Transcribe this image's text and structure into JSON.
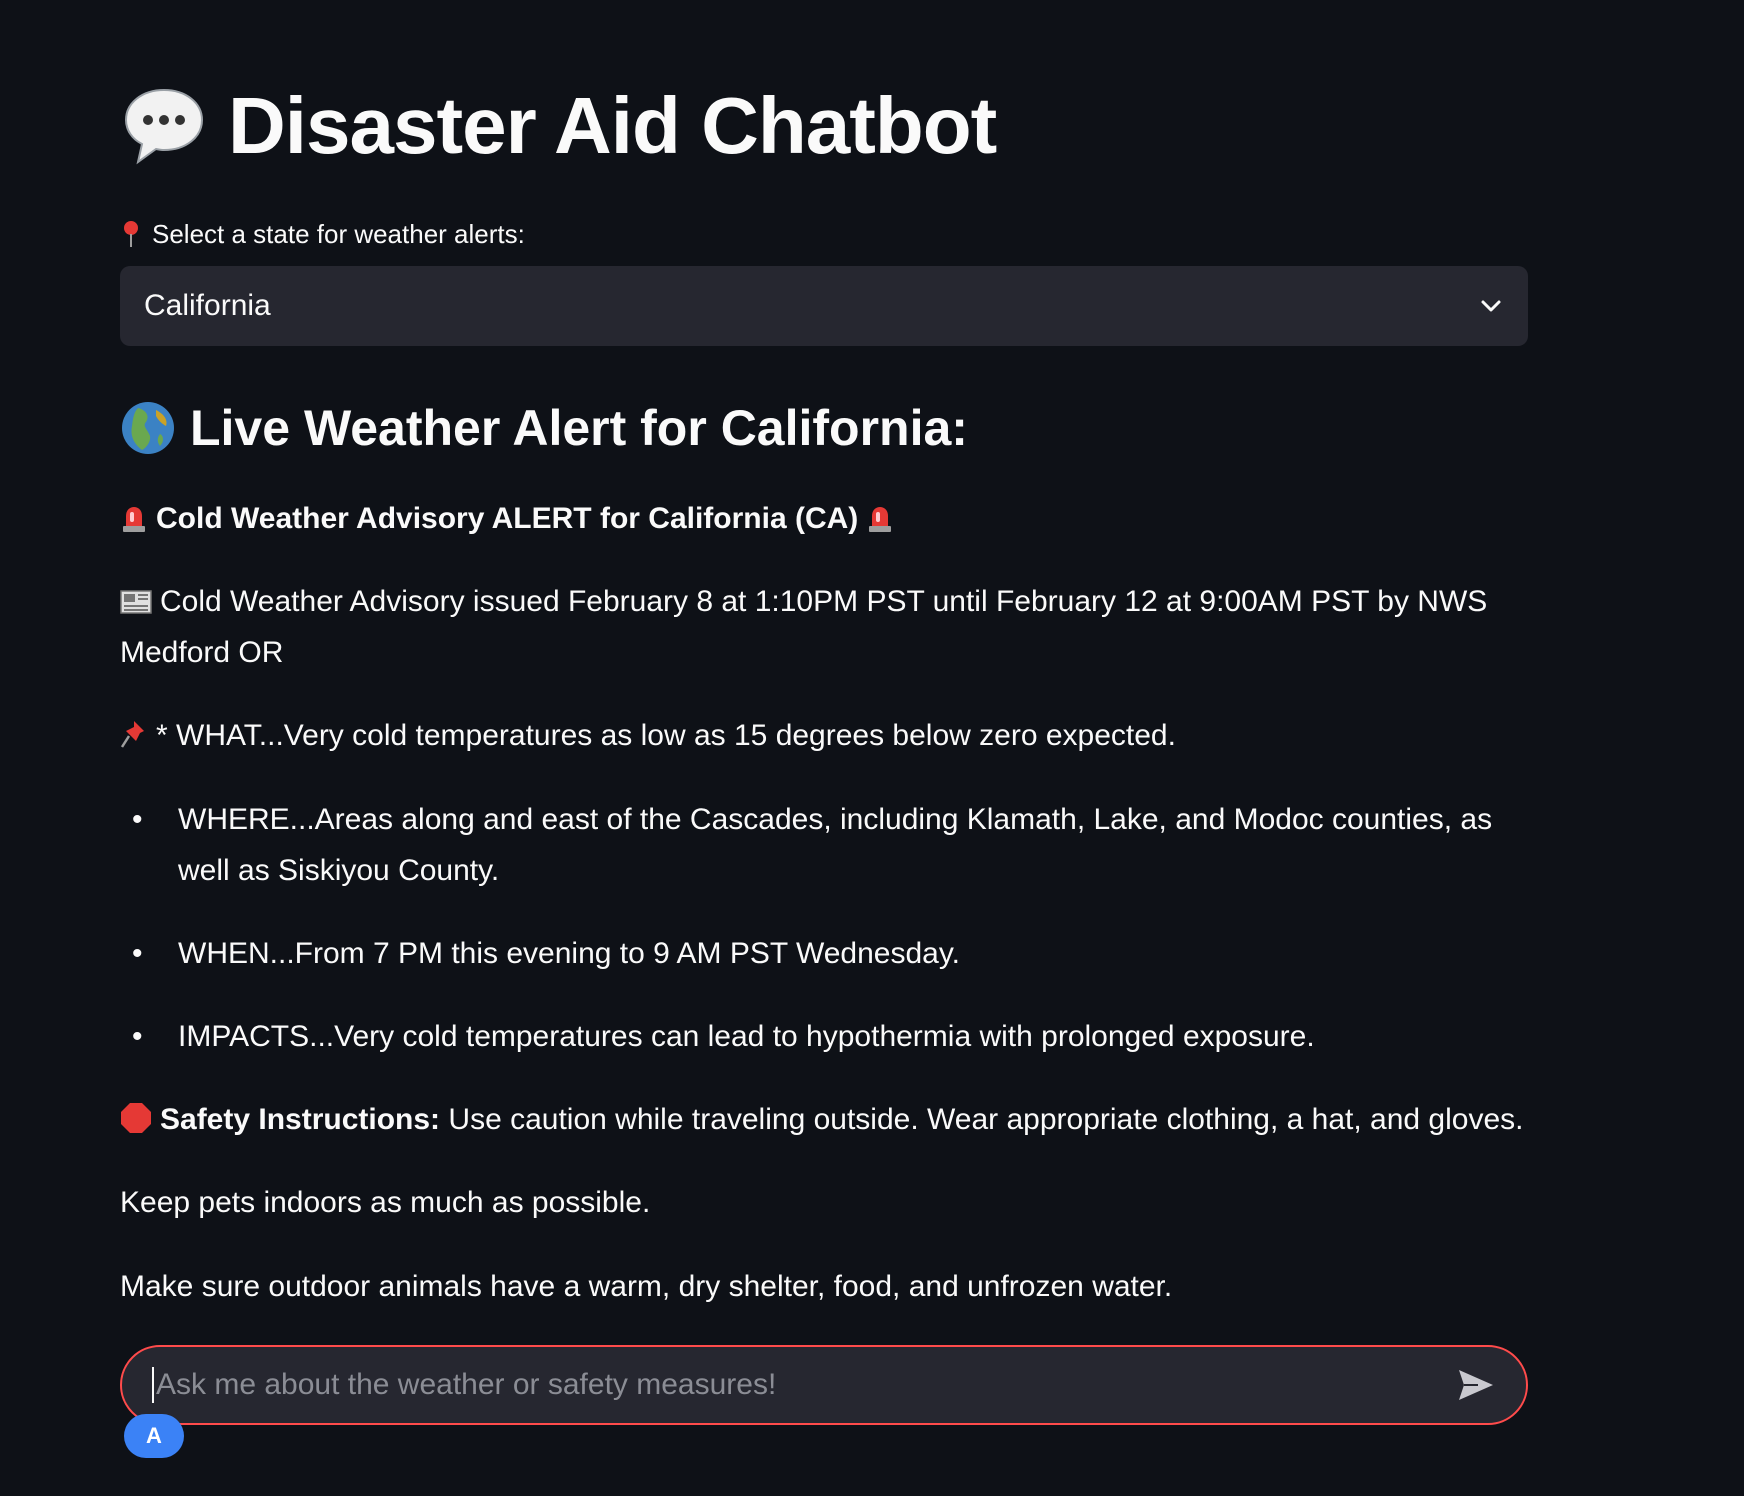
{
  "app": {
    "title": "Disaster Aid Chatbot",
    "title_icon": "speech-bubble-icon"
  },
  "state_select": {
    "label": "Select a state for weather alerts:",
    "label_icon": "round-pushpin-icon",
    "selected_value": "California"
  },
  "alert_section": {
    "heading": "Live Weather Alert for California:",
    "heading_icon": "globe-icon",
    "alert_title": "Cold Weather Advisory ALERT for California (CA)",
    "alert_title_icon": "siren-icon",
    "issued_text": "Cold Weather Advisory issued February 8 at 1:10PM PST until February 12 at 9:00AM PST by NWS Medford OR",
    "issued_icon": "newspaper-icon",
    "what_text": "* WHAT...Very cold temperatures as low as 15 degrees below zero expected.",
    "what_icon": "pushpin-icon",
    "bullets": [
      "WHERE...Areas along and east of the Cascades, including Klamath, Lake, and Modoc counties, as well as Siskiyou County.",
      "WHEN...From 7 PM this evening to 9 AM PST Wednesday.",
      "IMPACTS...Very cold temperatures can lead to hypothermia with prolonged exposure."
    ],
    "safety_label": "Safety Instructions:",
    "safety_icon": "stop-sign-icon",
    "safety_text": "Use caution while traveling outside. Wear appropriate clothing, a hat, and gloves.",
    "extra_lines": [
      "Keep pets indoors as much as possible.",
      "Make sure outdoor animals have a warm, dry shelter, food, and unfrozen water."
    ]
  },
  "chat_input": {
    "placeholder": "Ask me about the weather or safety measures!",
    "send_icon": "send-icon",
    "avatar_letter": "A"
  },
  "colors": {
    "background": "#0e1117",
    "input_background": "#262730",
    "focus_border": "#ff4b4b",
    "avatar": "#3b82f6",
    "text": "#fafafa"
  }
}
